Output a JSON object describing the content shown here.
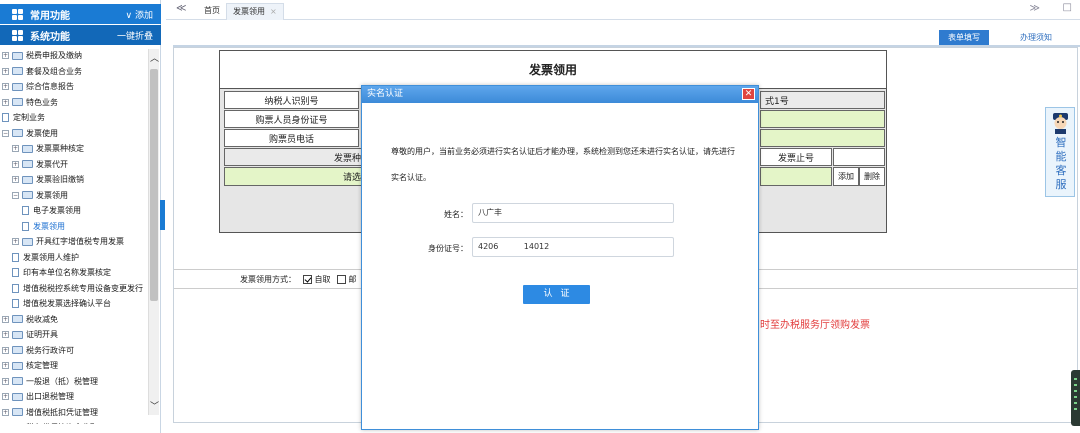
{
  "sidebar": {
    "common_bar": {
      "title": "常用功能",
      "action": "∨  添加"
    },
    "system_bar": {
      "title": "系统功能",
      "action": "一键折叠"
    },
    "tree": [
      {
        "label": "税费申报及缴纳",
        "level": 0,
        "kind": "folder",
        "exp": "+"
      },
      {
        "label": "套餐及组合业务",
        "level": 0,
        "kind": "folder",
        "exp": "+"
      },
      {
        "label": "综合信息报告",
        "level": 0,
        "kind": "folder",
        "exp": "+"
      },
      {
        "label": "特色业务",
        "level": 0,
        "kind": "folder",
        "exp": "+"
      },
      {
        "label": "定制业务",
        "level": 0,
        "kind": "doc",
        "exp": ""
      },
      {
        "label": "发票使用",
        "level": 0,
        "kind": "folder",
        "exp": "−"
      },
      {
        "label": "发票票种核定",
        "level": 1,
        "kind": "folder",
        "exp": "+"
      },
      {
        "label": "发票代开",
        "level": 1,
        "kind": "folder",
        "exp": "+"
      },
      {
        "label": "发票验旧缴销",
        "level": 1,
        "kind": "folder",
        "exp": "+"
      },
      {
        "label": "发票领用",
        "level": 1,
        "kind": "folder",
        "exp": "−"
      },
      {
        "label": "电子发票领用",
        "level": 2,
        "kind": "doc",
        "exp": ""
      },
      {
        "label": "发票领用",
        "level": 2,
        "kind": "doc",
        "exp": "",
        "selected": true
      },
      {
        "label": "开具红字增值税专用发票",
        "level": 1,
        "kind": "folder",
        "exp": "+"
      },
      {
        "label": "发票领用人维护",
        "level": 1,
        "kind": "doc",
        "exp": ""
      },
      {
        "label": "印有本单位名称发票核定",
        "level": 1,
        "kind": "doc",
        "exp": ""
      },
      {
        "label": "增值税税控系统专用设备变更发行",
        "level": 1,
        "kind": "doc",
        "exp": ""
      },
      {
        "label": "增值税发票选择确认平台",
        "level": 1,
        "kind": "doc",
        "exp": ""
      },
      {
        "label": "税收减免",
        "level": 0,
        "kind": "folder",
        "exp": "+"
      },
      {
        "label": "证明开具",
        "level": 0,
        "kind": "folder",
        "exp": "+"
      },
      {
        "label": "税务行政许可",
        "level": 0,
        "kind": "folder",
        "exp": "+"
      },
      {
        "label": "核定管理",
        "level": 0,
        "kind": "folder",
        "exp": "+"
      },
      {
        "label": "一般退（抵）税管理",
        "level": 0,
        "kind": "folder",
        "exp": "+"
      },
      {
        "label": "出口退税管理",
        "level": 0,
        "kind": "folder",
        "exp": "+"
      },
      {
        "label": "增值税抵扣凭证管理",
        "level": 0,
        "kind": "folder",
        "exp": "+"
      },
      {
        "label": "税务代保管资金收取",
        "level": 0,
        "kind": "folder",
        "exp": "+"
      }
    ]
  },
  "tabs": {
    "back": "≪",
    "home": "首页",
    "active": "发票领用",
    "close": "×",
    "forward": "≫",
    "window": "□"
  },
  "toolbar": {
    "form_fill": "表单填写",
    "notes": "办理须知"
  },
  "form": {
    "title": "发票领用",
    "taxpayer_id": "纳税人识别号",
    "buyer_id": "购票人员身份证号",
    "buyer_phone": "购票员电话",
    "invoice_type_partial": "发票种",
    "please_choose_partial": "请选",
    "format_partial": "式1号",
    "end_no": "发票止号",
    "add": "添加",
    "delete": "删除"
  },
  "mode": {
    "label": "发票领用方式：",
    "self": "自取",
    "mail": "邮"
  },
  "tip": "时至办税服务厅领购发票",
  "modal": {
    "title": "实名认证",
    "close": "✕",
    "message": "尊敬的用户，当前业务必须进行实名认证后才能办理，系统检测到您还未进行实名认证，请先进行实名认证。",
    "name_label": "姓名：",
    "name_value": "八广丰",
    "id_label": "身份证号：",
    "id_value": "4206          14012",
    "verify_button": "认证"
  },
  "helper": {
    "text": "智能客服"
  }
}
